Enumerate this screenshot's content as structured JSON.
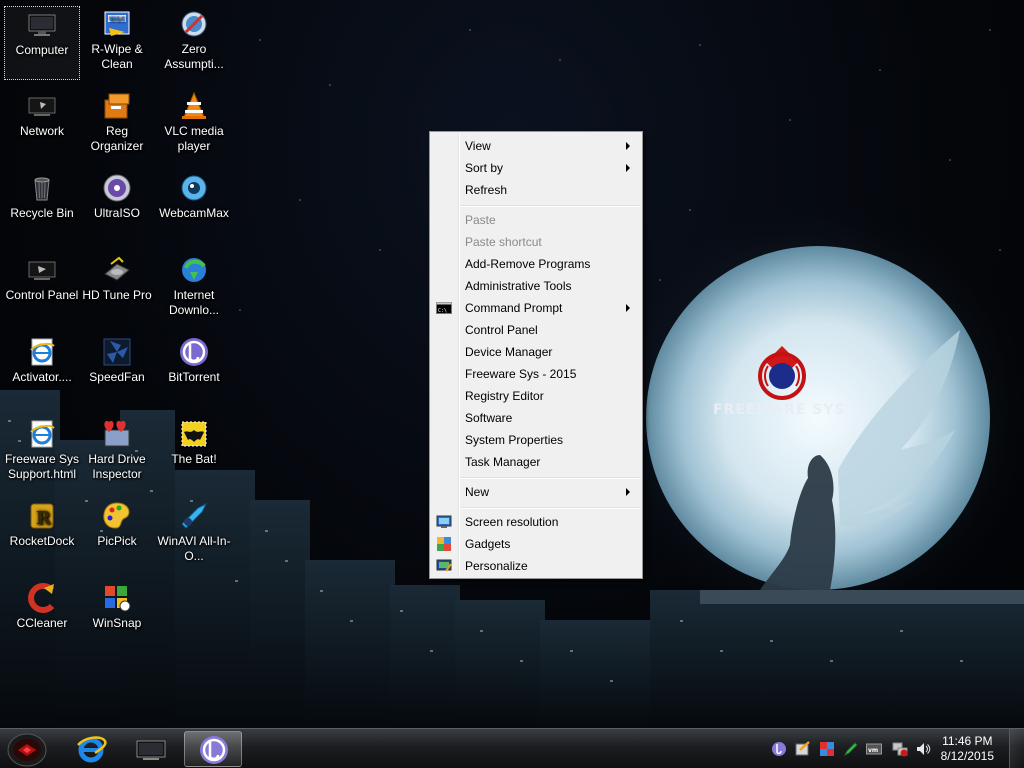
{
  "desktop": {
    "icons": [
      {
        "label": "Computer",
        "icon": "computer-icon"
      },
      {
        "label": "R-Wipe & Clean",
        "icon": "r-wipe-clean-icon"
      },
      {
        "label": "Zero Assumpti...",
        "icon": "zero-assumption-icon"
      },
      {
        "label": "Network",
        "icon": "network-icon"
      },
      {
        "label": "Reg Organizer",
        "icon": "reg-organizer-icon"
      },
      {
        "label": "VLC media player",
        "icon": "vlc-icon"
      },
      {
        "label": "Recycle Bin",
        "icon": "recycle-bin-icon"
      },
      {
        "label": "UltraISO",
        "icon": "ultraiso-icon"
      },
      {
        "label": "WebcamMax",
        "icon": "webcammax-icon"
      },
      {
        "label": "Control Panel",
        "icon": "control-panel-icon"
      },
      {
        "label": "HD Tune Pro",
        "icon": "hd-tune-pro-icon"
      },
      {
        "label": "Internet Downlo...",
        "icon": "internet-download-manager-icon"
      },
      {
        "label": "Activator....",
        "icon": "ie-document-icon"
      },
      {
        "label": "SpeedFan",
        "icon": "speedfan-icon"
      },
      {
        "label": "BitTorrent",
        "icon": "bittorrent-icon"
      },
      {
        "label": "Freeware Sys Support.html",
        "icon": "ie-document-icon"
      },
      {
        "label": "Hard Drive Inspector",
        "icon": "hard-drive-inspector-icon"
      },
      {
        "label": "The Bat!",
        "icon": "the-bat-icon"
      },
      {
        "label": "RocketDock",
        "icon": "rocketdock-icon"
      },
      {
        "label": "PicPick",
        "icon": "picpick-icon"
      },
      {
        "label": "WinAVI All-In-O...",
        "icon": "winavi-icon"
      },
      {
        "label": "CCleaner",
        "icon": "ccleaner-icon"
      },
      {
        "label": "WinSnap",
        "icon": "winsnap-icon"
      }
    ]
  },
  "wallpaper": {
    "brand_text": "FREEWARE SYS"
  },
  "context_menu": {
    "items": [
      {
        "label": "View",
        "submenu": true
      },
      {
        "label": "Sort by",
        "submenu": true
      },
      {
        "label": "Refresh"
      },
      {
        "label": "Paste",
        "disabled": true
      },
      {
        "label": "Paste shortcut",
        "disabled": true
      },
      {
        "label": "Add-Remove Programs"
      },
      {
        "label": "Administrative Tools"
      },
      {
        "label": "Command Prompt",
        "submenu": true,
        "icon": "command-prompt-icon"
      },
      {
        "label": "Control Panel"
      },
      {
        "label": "Device Manager"
      },
      {
        "label": "Freeware Sys - 2015"
      },
      {
        "label": "Registry Editor"
      },
      {
        "label": "Software"
      },
      {
        "label": "System Properties"
      },
      {
        "label": "Task Manager"
      },
      {
        "label": "New",
        "submenu": true
      },
      {
        "label": "Screen resolution",
        "icon": "screen-resolution-icon"
      },
      {
        "label": "Gadgets",
        "icon": "gadgets-icon"
      },
      {
        "label": "Personalize",
        "icon": "personalize-icon"
      }
    ]
  },
  "taskbar": {
    "pinned": [
      {
        "name": "internet-explorer",
        "icon": "internet-explorer-icon"
      },
      {
        "name": "windows-explorer",
        "icon": "monitor-icon"
      },
      {
        "name": "bittorrent",
        "icon": "bittorrent-icon",
        "active": true
      }
    ],
    "tray_icons": [
      "bittorrent-tray-icon",
      "tool-tray-icon",
      "shield-tray-icon",
      "edit-tray-icon",
      "vmware-tray-icon",
      "network-tray-icon",
      "volume-tray-icon"
    ],
    "clock": {
      "time": "11:46 PM",
      "date": "8/12/2015"
    }
  },
  "colors": {
    "menu_bg": "#f0f0f0",
    "menu_disabled_text": "#8a8a8a",
    "taskbar_dark": "#1c1e21",
    "moon": "#dfeef5"
  }
}
